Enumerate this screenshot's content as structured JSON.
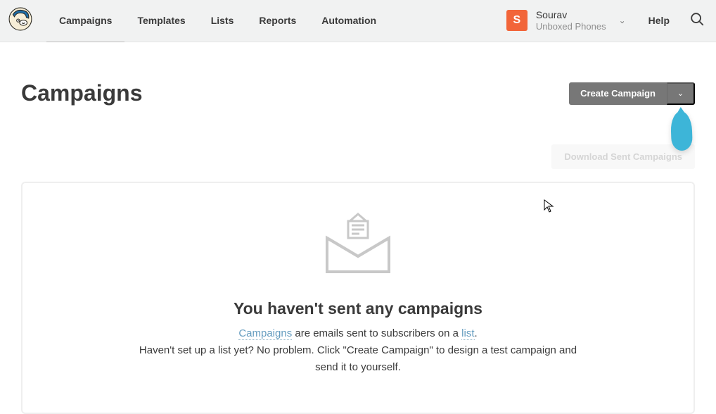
{
  "nav": {
    "items": [
      "Campaigns",
      "Templates",
      "Lists",
      "Reports",
      "Automation"
    ],
    "active_index": 0
  },
  "account": {
    "initial": "S",
    "name": "Sourav",
    "org": "Unboxed Phones"
  },
  "help_label": "Help",
  "page": {
    "title": "Campaigns",
    "create_label": "Create Campaign",
    "download_label": "Download Sent Campaigns"
  },
  "empty": {
    "title": "You haven't sent any campaigns",
    "link1": "Campaigns",
    "mid1": " are emails sent to subscribers on a ",
    "link2": "list",
    "tail1": ".",
    "line2": "Haven't set up a list yet? No problem. Click \"Create Campaign\" to design a test campaign and send it to yourself."
  }
}
